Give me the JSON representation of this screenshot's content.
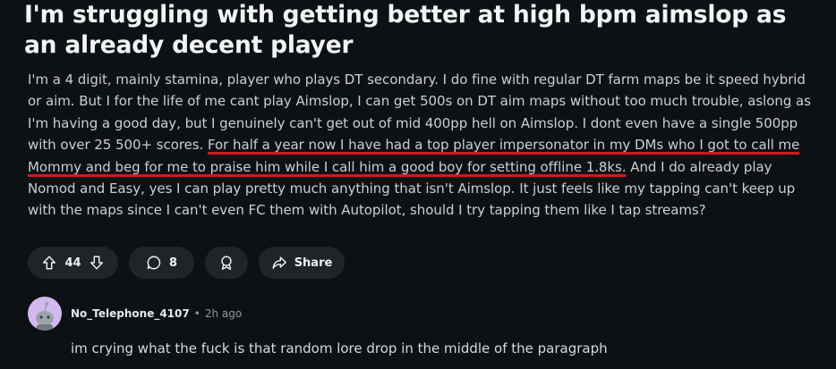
{
  "post": {
    "title": "I'm struggling with getting better at high bpm aimslop as an already decent player",
    "body_before": "I'm a 4 digit, mainly stamina, player who plays DT secondary. I do fine with regular DT farm maps be it speed hybrid or aim. But I for the life of me cant play Aimslop, I can get 500s on DT aim maps without too much trouble, aslong as I'm having a good day, but I genuinely can't get out of mid 400pp hell on Aimslop. I dont even have a single 500pp with over 25 500+ scores. ",
    "body_highlight": "For half a year now I have had a top player impersonator in my DMs who I got to call me Mommy and beg for me to praise him while I call him a good boy for setting offline 1.8ks.",
    "body_after": " And I do already play Nomod and Easy, yes I can play pretty much anything that isn't Aimslop. It just feels like my tapping can't keep up with the maps since I can't even FC them with Autopilot, should I try tapping them like I tap streams?",
    "highlight_color": "#d11a1a"
  },
  "actions": {
    "upvote_icon": "arrow-up-icon",
    "vote_count": "44",
    "downvote_icon": "arrow-down-icon",
    "comment_icon": "speech-bubble-icon",
    "comment_count": "8",
    "award_icon": "award-icon",
    "share_icon": "share-arrow-icon",
    "share_label": "Share"
  },
  "comment": {
    "username": "No_Telephone_4107",
    "separator": "•",
    "time": "2h ago",
    "text": "im crying what the fuck is that random lore drop in the middle of the paragraph",
    "avatar_color": "#d3b8ef"
  }
}
